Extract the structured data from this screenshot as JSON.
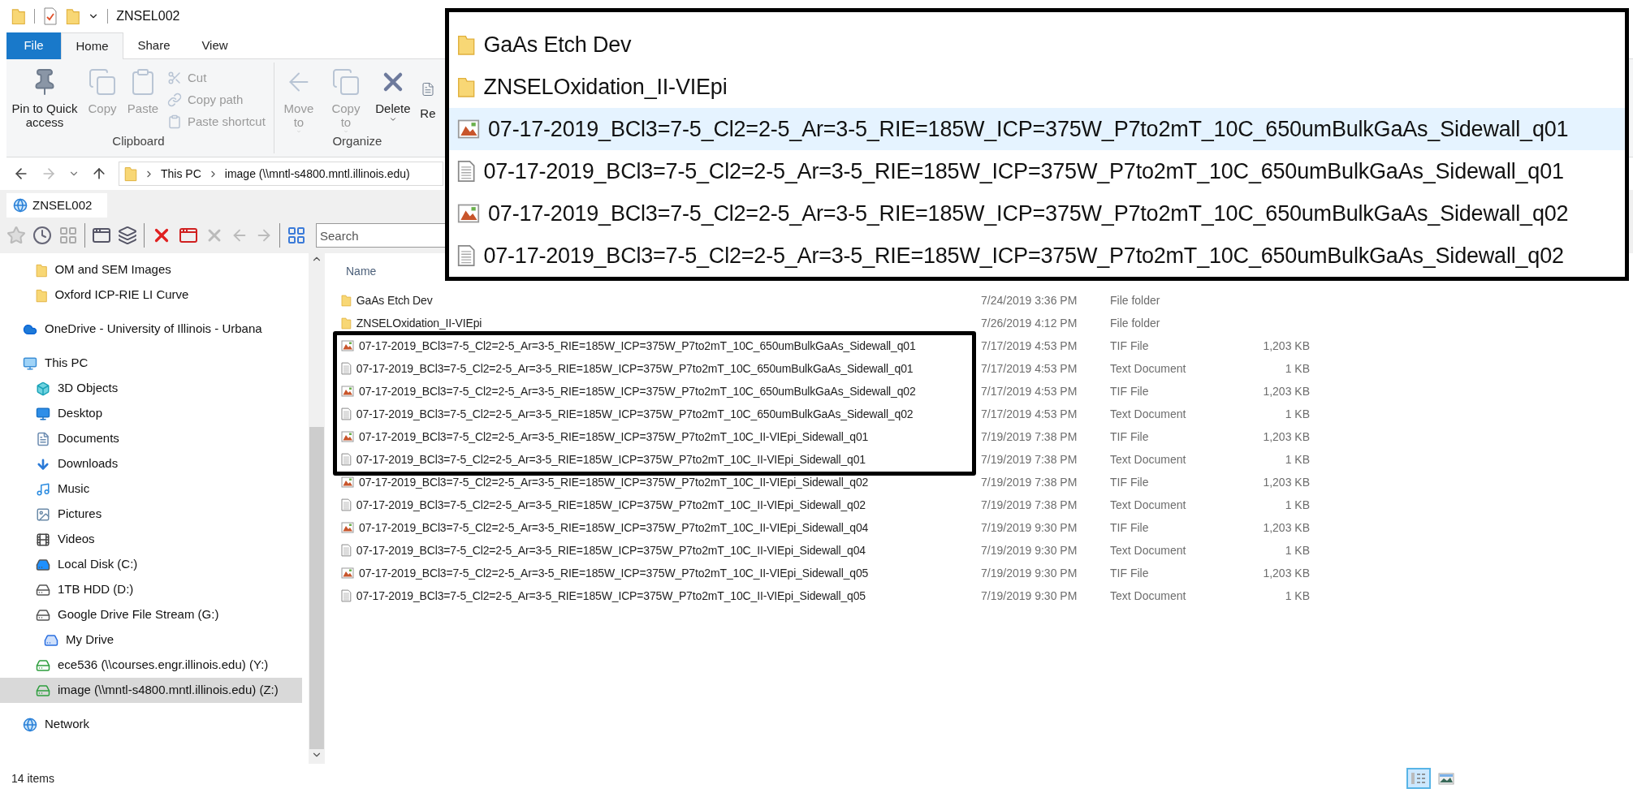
{
  "title_bar": {
    "title": "ZNSEL002"
  },
  "ribbon": {
    "tabs": [
      {
        "label": "File",
        "kind": "file",
        "selected": false
      },
      {
        "label": "Home",
        "kind": "tab",
        "selected": true
      },
      {
        "label": "Share",
        "kind": "tab",
        "selected": false
      },
      {
        "label": "View",
        "kind": "tab",
        "selected": false
      }
    ],
    "groups": [
      {
        "label": "Clipboard",
        "buttons": [
          {
            "label": "Pin to Quick access",
            "kind": "pin",
            "disabled": false
          },
          {
            "label": "Copy",
            "kind": "copy",
            "disabled": true
          },
          {
            "label": "Paste",
            "kind": "paste",
            "disabled": true
          },
          {
            "label": "Cut",
            "kind": "cut",
            "disabled": true
          },
          {
            "label": "Copy path",
            "kind": "copypath",
            "disabled": true
          },
          {
            "label": "Paste shortcut",
            "kind": "shortcut",
            "disabled": true
          }
        ]
      },
      {
        "label": "Organize",
        "buttons": [
          {
            "label": "Move to",
            "kind": "move",
            "disabled": true
          },
          {
            "label": "Copy to",
            "kind": "copyto",
            "disabled": true
          },
          {
            "label": "Delete",
            "kind": "delete",
            "disabled": false
          },
          {
            "label": "Re",
            "kind": "rename",
            "disabled": false
          }
        ]
      }
    ]
  },
  "address_bar": {
    "crumbs": [
      "This PC",
      "image (\\\\mntl-s4800.mntl.illinois.edu)"
    ]
  },
  "folder_tab": {
    "label": "ZNSEL002"
  },
  "toolbar": {
    "search": {
      "placeholder": "Search"
    }
  },
  "sidebar": {
    "scrolled_parent_children": [
      {
        "label": "OM and SEM Images",
        "kind": "folder",
        "selected": false
      },
      {
        "label": "Oxford ICP-RIE LI Curve",
        "kind": "folder",
        "selected": false
      }
    ],
    "items": [
      {
        "label": "OneDrive - University of Illinois - Urbana",
        "kind": "cloud",
        "selected": false
      },
      {
        "label": "This PC",
        "kind": "pc",
        "selected": false,
        "children": [
          {
            "label": "3D Objects",
            "kind": "cube",
            "selected": false
          },
          {
            "label": "Desktop",
            "kind": "desktop",
            "selected": false
          },
          {
            "label": "Documents",
            "kind": "documents",
            "selected": false
          },
          {
            "label": "Downloads",
            "kind": "downloads",
            "selected": false
          },
          {
            "label": "Music",
            "kind": "music",
            "selected": false
          },
          {
            "label": "Pictures",
            "kind": "pictures",
            "selected": false
          },
          {
            "label": "Videos",
            "kind": "videos",
            "selected": false
          },
          {
            "label": "Local Disk (C:)",
            "kind": "localdisk",
            "selected": false
          },
          {
            "label": "1TB HDD (D:)",
            "kind": "drive",
            "selected": false
          },
          {
            "label": "Google Drive File Stream (G:)",
            "kind": "drive",
            "selected": false,
            "children": [
              {
                "label": "My Drive",
                "kind": "gdrive",
                "selected": false
              }
            ]
          },
          {
            "label": "ece536 (\\\\courses.engr.illinois.edu) (Y:)",
            "kind": "netdrive",
            "selected": false
          },
          {
            "label": "image (\\\\mntl-s4800.mntl.illinois.edu) (Z:)",
            "kind": "netdrive",
            "selected": true
          }
        ]
      },
      {
        "label": "Network",
        "kind": "network",
        "selected": false
      }
    ]
  },
  "file_list": {
    "columns": [
      "Name"
    ],
    "rows": [
      {
        "name": "GaAs Etch Dev",
        "kind": "folder",
        "date": "7/24/2019 3:36 PM",
        "type": "File folder"
      },
      {
        "name": "ZNSELOxidation_II-VIEpi",
        "kind": "folder",
        "date": "7/26/2019 4:12 PM",
        "type": "File folder"
      },
      {
        "name": "07-17-2019_BCl3=7-5_Cl2=2-5_Ar=3-5_RIE=185W_ICP=375W_P7to2mT_10C_650umBulkGaAs_Sidewall_q01",
        "kind": "image",
        "date": "7/17/2019 4:53 PM",
        "type": "TIF File",
        "size": "1,203 KB"
      },
      {
        "name": "07-17-2019_BCl3=7-5_Cl2=2-5_Ar=3-5_RIE=185W_ICP=375W_P7to2mT_10C_650umBulkGaAs_Sidewall_q01",
        "kind": "text",
        "date": "7/17/2019 4:53 PM",
        "type": "Text Document",
        "size": "1 KB"
      },
      {
        "name": "07-17-2019_BCl3=7-5_Cl2=2-5_Ar=3-5_RIE=185W_ICP=375W_P7to2mT_10C_650umBulkGaAs_Sidewall_q02",
        "kind": "image",
        "date": "7/17/2019 4:53 PM",
        "type": "TIF File",
        "size": "1,203 KB"
      },
      {
        "name": "07-17-2019_BCl3=7-5_Cl2=2-5_Ar=3-5_RIE=185W_ICP=375W_P7to2mT_10C_650umBulkGaAs_Sidewall_q02",
        "kind": "text",
        "date": "7/17/2019 4:53 PM",
        "type": "Text Document",
        "size": "1 KB"
      },
      {
        "name": "07-17-2019_BCl3=7-5_Cl2=2-5_Ar=3-5_RIE=185W_ICP=375W_P7to2mT_10C_II-VIEpi_Sidewall_q01",
        "kind": "image",
        "date": "7/19/2019 7:38 PM",
        "type": "TIF File",
        "size": "1,203 KB"
      },
      {
        "name": "07-17-2019_BCl3=7-5_Cl2=2-5_Ar=3-5_RIE=185W_ICP=375W_P7to2mT_10C_II-VIEpi_Sidewall_q01",
        "kind": "text",
        "date": "7/19/2019 7:38 PM",
        "type": "Text Document",
        "size": "1 KB"
      },
      {
        "name": "07-17-2019_BCl3=7-5_Cl2=2-5_Ar=3-5_RIE=185W_ICP=375W_P7to2mT_10C_II-VIEpi_Sidewall_q02",
        "kind": "image",
        "date": "7/19/2019 7:38 PM",
        "type": "TIF File",
        "size": "1,203 KB"
      },
      {
        "name": "07-17-2019_BCl3=7-5_Cl2=2-5_Ar=3-5_RIE=185W_ICP=375W_P7to2mT_10C_II-VIEpi_Sidewall_q02",
        "kind": "text",
        "date": "7/19/2019 7:38 PM",
        "type": "Text Document",
        "size": "1 KB"
      },
      {
        "name": "07-17-2019_BCl3=7-5_Cl2=2-5_Ar=3-5_RIE=185W_ICP=375W_P7to2mT_10C_II-VIEpi_Sidewall_q04",
        "kind": "image",
        "date": "7/19/2019 9:30 PM",
        "type": "TIF File",
        "size": "1,203 KB"
      },
      {
        "name": "07-17-2019_BCl3=7-5_Cl2=2-5_Ar=3-5_RIE=185W_ICP=375W_P7to2mT_10C_II-VIEpi_Sidewall_q04",
        "kind": "text",
        "date": "7/19/2019 9:30 PM",
        "type": "Text Document",
        "size": "1 KB"
      },
      {
        "name": "07-17-2019_BCl3=7-5_Cl2=2-5_Ar=3-5_RIE=185W_ICP=375W_P7to2mT_10C_II-VIEpi_Sidewall_q05",
        "kind": "image",
        "date": "7/19/2019 9:30 PM",
        "type": "TIF File",
        "size": "1,203 KB"
      },
      {
        "name": "07-17-2019_BCl3=7-5_Cl2=2-5_Ar=3-5_RIE=185W_ICP=375W_P7to2mT_10C_II-VIEpi_Sidewall_q05",
        "kind": "text",
        "date": "7/19/2019 9:30 PM",
        "type": "Text Document",
        "size": "1 KB"
      }
    ]
  },
  "status_bar": {
    "count": "14 items",
    "views": [
      {
        "kind": "details",
        "selected": true
      },
      {
        "kind": "preview",
        "selected": false
      }
    ]
  },
  "zoom_inset": {
    "rows": [
      {
        "name": "GaAs Etch Dev",
        "kind": "folder",
        "highlighted": false
      },
      {
        "name": "ZNSELOxidation_II-VIEpi",
        "kind": "folder",
        "highlighted": false
      },
      {
        "name": "07-17-2019_BCl3=7-5_Cl2=2-5_Ar=3-5_RIE=185W_ICP=375W_P7to2mT_10C_650umBulkGaAs_Sidewall_q01",
        "kind": "image",
        "highlighted": true
      },
      {
        "name": "07-17-2019_BCl3=7-5_Cl2=2-5_Ar=3-5_RIE=185W_ICP=375W_P7to2mT_10C_650umBulkGaAs_Sidewall_q01",
        "kind": "text",
        "highlighted": false
      },
      {
        "name": "07-17-2019_BCl3=7-5_Cl2=2-5_Ar=3-5_RIE=185W_ICP=375W_P7to2mT_10C_650umBulkGaAs_Sidewall_q02",
        "kind": "image",
        "highlighted": false
      },
      {
        "name": "07-17-2019_BCl3=7-5_Cl2=2-5_Ar=3-5_RIE=185W_ICP=375W_P7to2mT_10C_650umBulkGaAs_Sidewall_q02",
        "kind": "text",
        "highlighted": false
      }
    ]
  }
}
